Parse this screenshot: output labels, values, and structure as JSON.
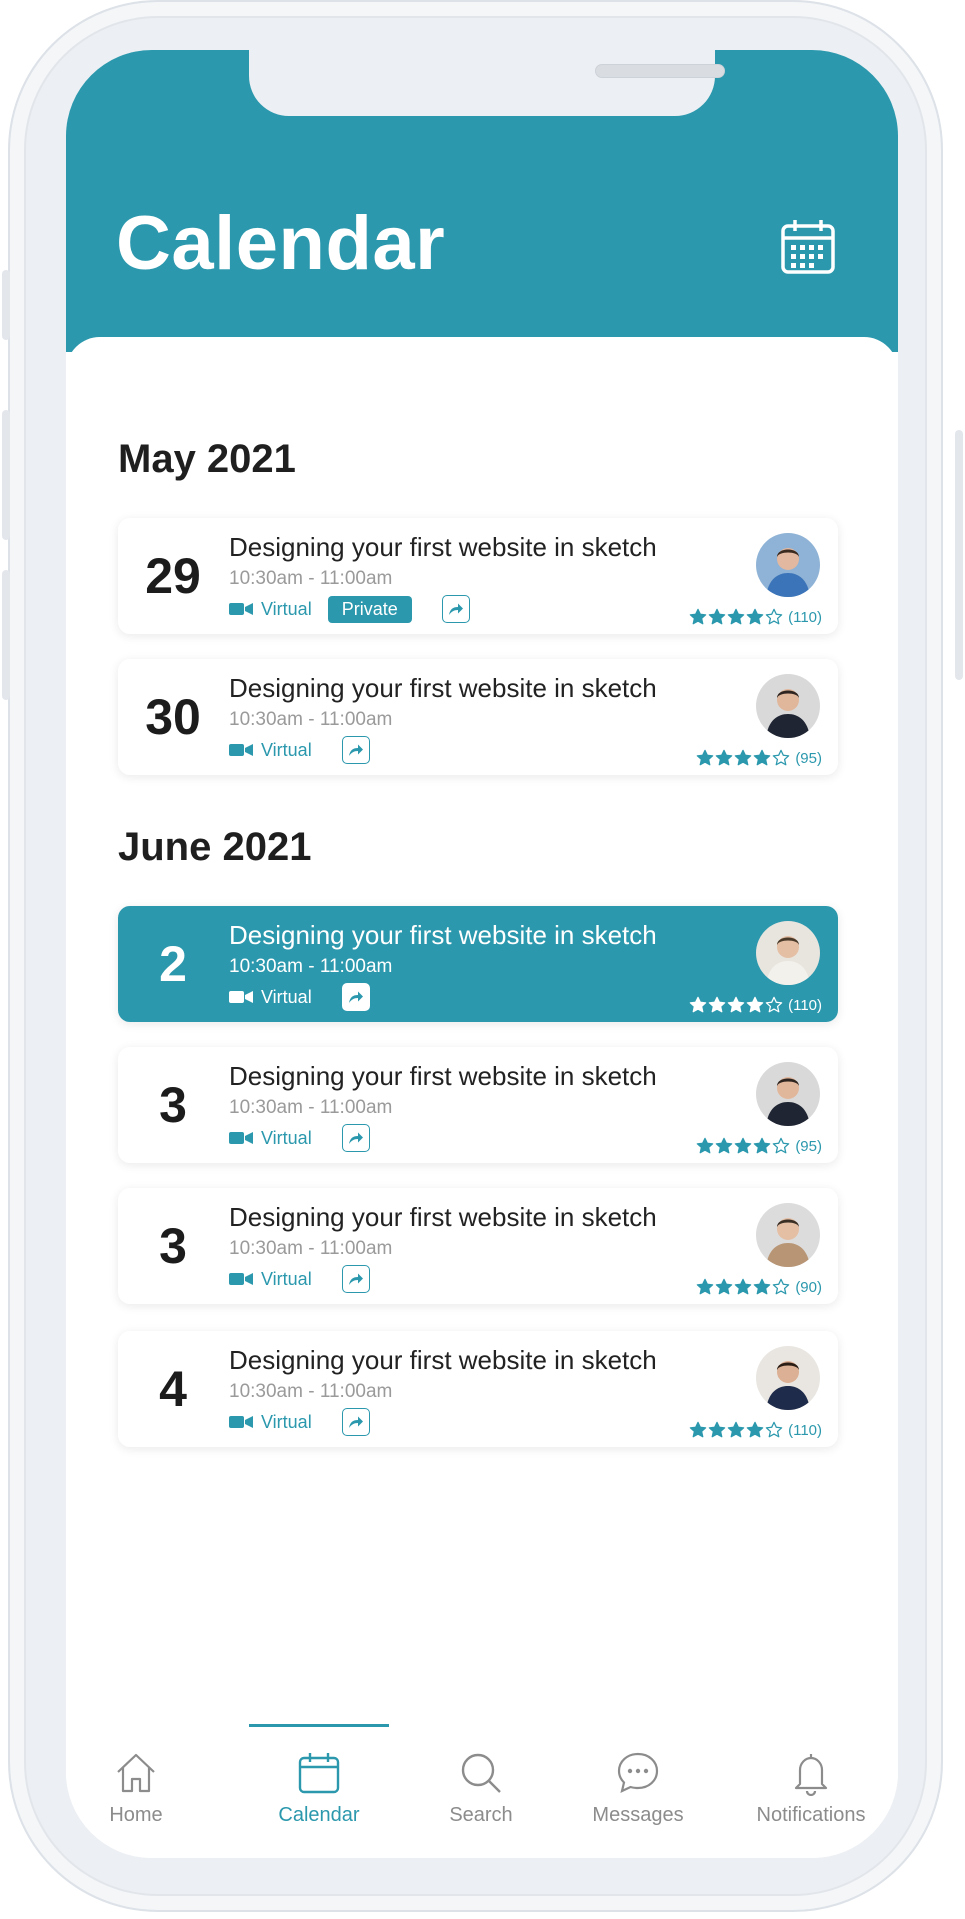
{
  "header": {
    "title": "Calendar"
  },
  "months": [
    {
      "label": "May 2021",
      "events": [
        {
          "date": "29",
          "title": "Designing your first website in sketch",
          "time": "10:30am - 11:00am",
          "mode": "Virtual",
          "badge": "Private",
          "rating": 4,
          "reviews": "(110)",
          "active": false,
          "avatar": "blue"
        },
        {
          "date": "30",
          "title": "Designing your first website in sketch",
          "time": "10:30am - 11:00am",
          "mode": "Virtual",
          "badge": "",
          "rating": 4,
          "reviews": "(95)",
          "active": false,
          "avatar": "dark"
        }
      ]
    },
    {
      "label": "June 2021",
      "events": [
        {
          "date": "2",
          "title": "Designing your first website in sketch",
          "time": "10:30am - 11:00am",
          "mode": "Virtual",
          "badge": "",
          "rating": 4,
          "reviews": "(110)",
          "active": true,
          "avatar": "white"
        },
        {
          "date": "3",
          "title": "Designing your first website in sketch",
          "time": "10:30am - 11:00am",
          "mode": "Virtual",
          "badge": "",
          "rating": 4,
          "reviews": "(95)",
          "active": false,
          "avatar": "dark"
        },
        {
          "date": "3",
          "title": "Designing your first website in sketch",
          "time": "10:30am - 11:00am",
          "mode": "Virtual",
          "badge": "",
          "rating": 4,
          "reviews": "(90)",
          "active": false,
          "avatar": "tan"
        },
        {
          "date": "4",
          "title": "Designing your first website in sketch",
          "time": "10:30am - 11:00am",
          "mode": "Virtual",
          "badge": "",
          "rating": 4,
          "reviews": "(110)",
          "active": false,
          "avatar": "navy"
        }
      ]
    }
  ],
  "tabs": [
    {
      "label": "Home",
      "icon": "home-icon",
      "active": false
    },
    {
      "label": "Calendar",
      "icon": "calendar-icon",
      "active": true
    },
    {
      "label": "Search",
      "icon": "search-icon",
      "active": false
    },
    {
      "label": "Messages",
      "icon": "chat-icon",
      "active": false
    },
    {
      "label": "Notifications",
      "icon": "bell-icon",
      "active": false
    }
  ],
  "colors": {
    "accent": "#2b98ad",
    "text": "#222222",
    "muted": "#9a9a9a"
  }
}
